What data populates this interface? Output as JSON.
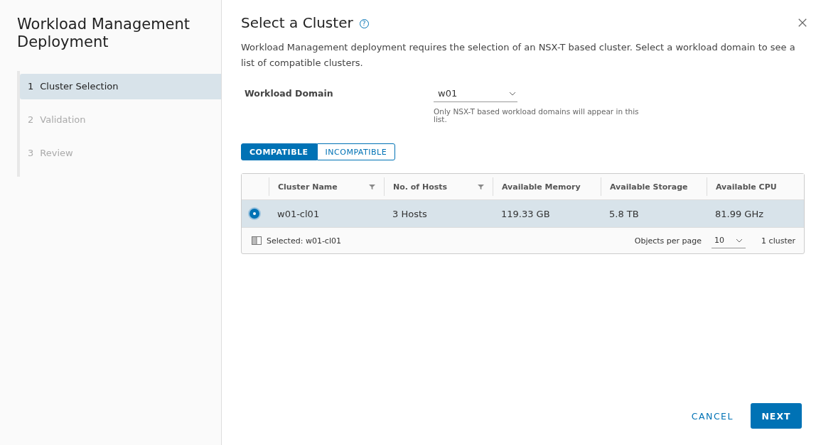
{
  "sidebar": {
    "title": "Workload Management Deployment",
    "steps": [
      {
        "number": "1",
        "label": "Cluster Selection",
        "selected": true
      },
      {
        "number": "2",
        "label": "Validation",
        "selected": false
      },
      {
        "number": "3",
        "label": "Review",
        "selected": false
      }
    ]
  },
  "page": {
    "title": "Select a Cluster",
    "help_icon": "?",
    "description": "Workload Management deployment requires the selection of an NSX-T based cluster. Select a workload domain to see a list of compatible clusters."
  },
  "workload_domain": {
    "label": "Workload Domain",
    "value": "w01",
    "hint": "Only NSX-T based workload domains will appear in this list."
  },
  "tabs": [
    {
      "label": "COMPATIBLE",
      "selected": true
    },
    {
      "label": "INCOMPATIBLE",
      "selected": false
    }
  ],
  "table": {
    "columns": [
      {
        "label": "Cluster Name",
        "filter": true
      },
      {
        "label": "No. of Hosts",
        "filter": true
      },
      {
        "label": "Available Memory",
        "filter": false
      },
      {
        "label": "Available Storage",
        "filter": false
      },
      {
        "label": "Available CPU",
        "filter": false
      }
    ],
    "rows": [
      {
        "selected": true,
        "cells": [
          "w01-cl01",
          "3 Hosts",
          "119.33 GB",
          "5.8 TB",
          "81.99 GHz"
        ]
      }
    ],
    "footer": {
      "selection": "Selected: w01-cl01",
      "per_page_label": "Objects per page",
      "per_page": "10",
      "count": "1 cluster"
    }
  },
  "buttons": {
    "cancel": "CANCEL",
    "next": "NEXT"
  }
}
